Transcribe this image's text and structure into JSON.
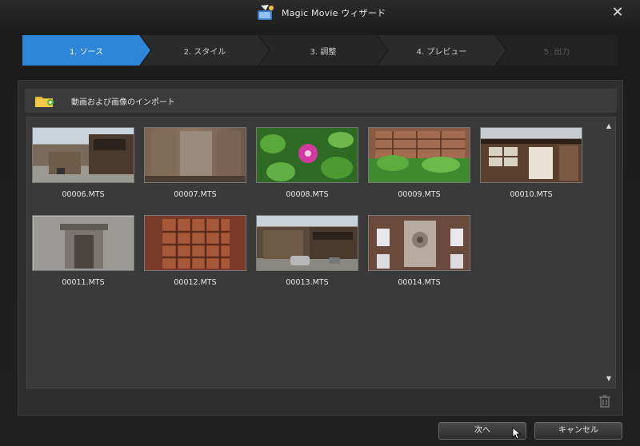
{
  "window": {
    "title": "Magic Movie ウィザード"
  },
  "steps": [
    {
      "label": "1. ソース",
      "active": true
    },
    {
      "label": "2. スタイル",
      "active": false
    },
    {
      "label": "3. 調整",
      "active": false
    },
    {
      "label": "4. プレビュー",
      "active": false
    },
    {
      "label": "5. 出力",
      "active": false
    }
  ],
  "import": {
    "label": "動画および画像のインポート"
  },
  "media": [
    {
      "name": "00006.MTS",
      "scene": "street"
    },
    {
      "name": "00007.MTS",
      "scene": "wall"
    },
    {
      "name": "00008.MTS",
      "scene": "flower"
    },
    {
      "name": "00009.MTS",
      "scene": "window-plants"
    },
    {
      "name": "00010.MTS",
      "scene": "house"
    },
    {
      "name": "00011.MTS",
      "scene": "concrete"
    },
    {
      "name": "00012.MTS",
      "scene": "lattice"
    },
    {
      "name": "00013.MTS",
      "scene": "street2"
    },
    {
      "name": "00014.MTS",
      "scene": "brick"
    }
  ],
  "footer": {
    "next_label": "次へ",
    "cancel_label": "キャンセル"
  },
  "colors": {
    "active_step": "#2e86d9",
    "inactive_step": "#2a2a2a",
    "background": "#1c1c1c"
  }
}
